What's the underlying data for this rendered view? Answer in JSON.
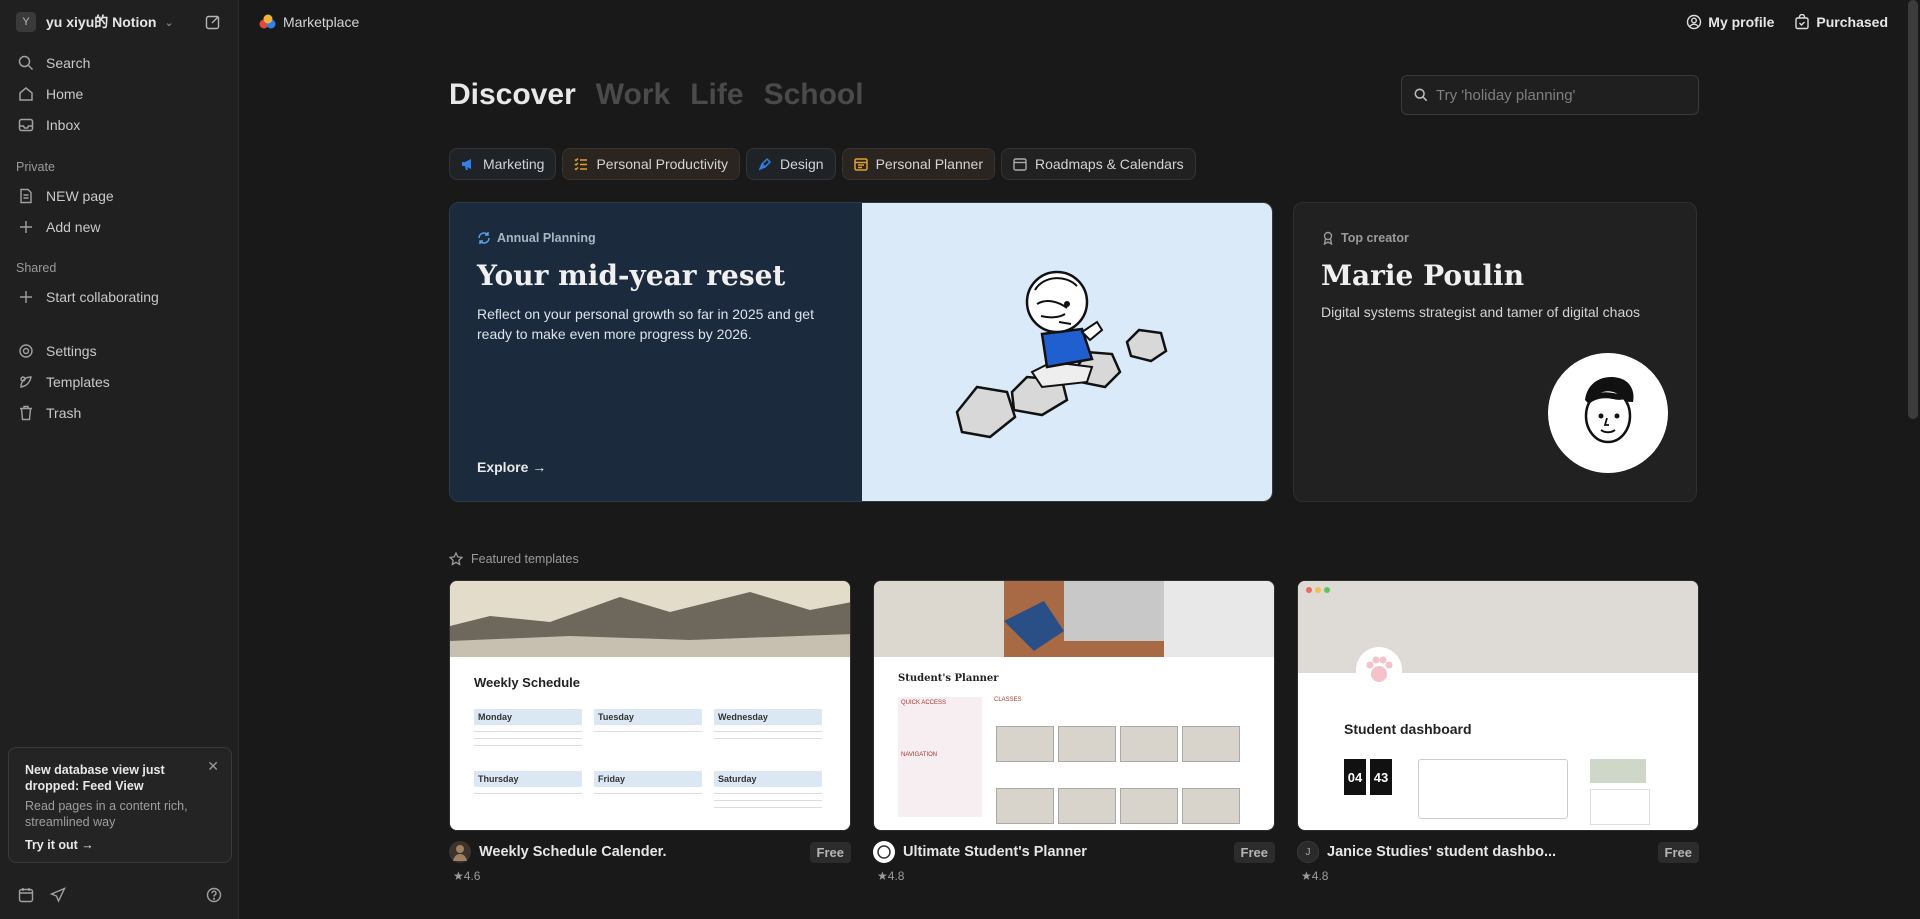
{
  "workspace": {
    "avatar": "Y",
    "name": "yu xiyu的 Notion"
  },
  "nav": {
    "search": "Search",
    "home": "Home",
    "inbox": "Inbox"
  },
  "private": {
    "label": "Private",
    "items": [
      "NEW page",
      "Add new"
    ]
  },
  "shared": {
    "label": "Shared",
    "start": "Start collaborating"
  },
  "bottom_nav": {
    "settings": "Settings",
    "templates": "Templates",
    "trash": "Trash"
  },
  "notice": {
    "title": "New database view just dropped: Feed View",
    "body": "Read pages in a content rich, streamlined way",
    "cta": "Try it out"
  },
  "topbar": {
    "breadcrumb": "Marketplace",
    "my_profile": "My profile",
    "purchased": "Purchased"
  },
  "tabs": [
    "Discover",
    "Work",
    "Life",
    "School"
  ],
  "search": {
    "placeholder": "Try 'holiday planning'"
  },
  "chips": [
    "Marketing",
    "Personal Productivity",
    "Design",
    "Personal Planner",
    "Roadmaps & Calendars"
  ],
  "hero": {
    "kicker": "Annual Planning",
    "title": "Your mid-year reset",
    "description": "Reflect on your personal growth so far in 2025 and get ready to make even more progress by 2026.",
    "cta": "Explore"
  },
  "creator": {
    "kicker": "Top creator",
    "name": "Marie Poulin",
    "description": "Digital systems strategist and tamer of digital chaos"
  },
  "featured": {
    "label": "Featured templates",
    "cards": [
      {
        "title": "Weekly Schedule Calender.",
        "badge": "Free",
        "rating": "4.6"
      },
      {
        "title": "Ultimate Student's Planner",
        "badge": "Free",
        "rating": "4.8"
      },
      {
        "avatar": "J",
        "title": "Janice Studies' student dashbo...",
        "badge": "Free",
        "rating": "4.8"
      }
    ]
  },
  "thumb1": {
    "heading": "Weekly Schedule",
    "days": [
      "Monday",
      "Tuesday",
      "Wednesday",
      "Thursday",
      "Friday",
      "Saturday"
    ]
  },
  "thumb2": {
    "heading": "Student's Planner",
    "quick": "QUICK ACCESS",
    "classes": "CLASSES",
    "navigation": "NAVIGATION"
  },
  "thumb3": {
    "heading": "Student dashboard",
    "clock_h": "04",
    "clock_m": "43"
  },
  "colors": {
    "accent_blue": "#2f80ed",
    "hero_bg": "#1b2a3c",
    "hero_illustration_bg": "#dbeaf8"
  }
}
